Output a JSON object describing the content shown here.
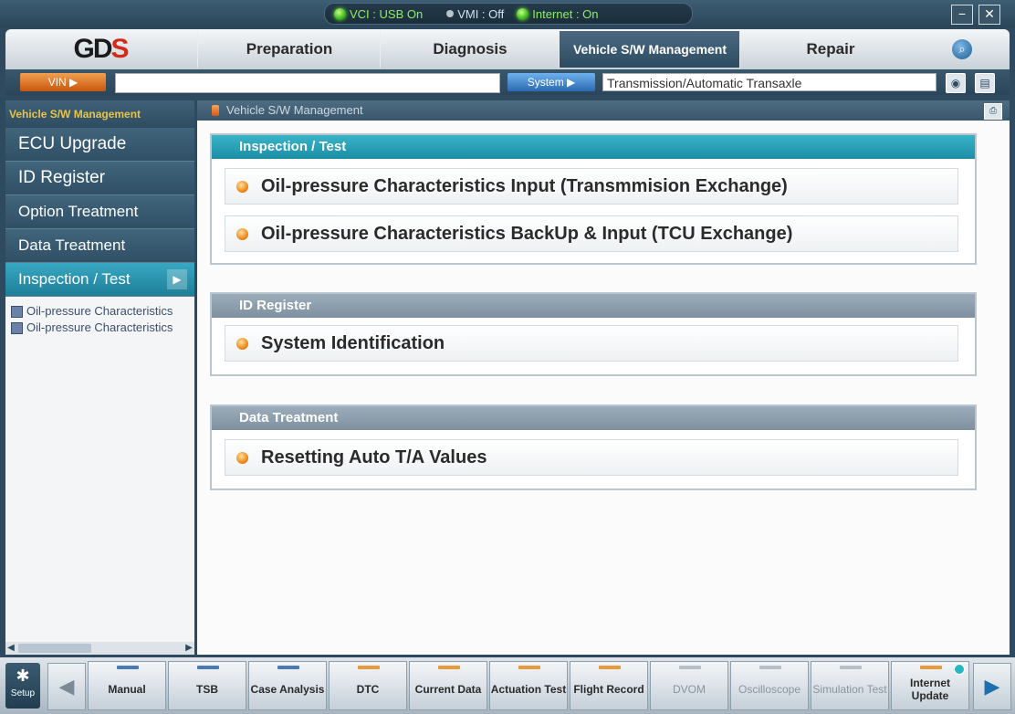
{
  "status": {
    "vci": "VCI : USB On",
    "vmi": "VMI : Off",
    "internet": "Internet : On"
  },
  "window": {
    "minimize": "−",
    "close": "✕"
  },
  "logo": {
    "part1": "GD",
    "part2": "S"
  },
  "menu": {
    "tabs": [
      {
        "label": "Preparation"
      },
      {
        "label": "Diagnosis"
      },
      {
        "label": "Vehicle S/W Management"
      },
      {
        "label": "Repair"
      }
    ],
    "search_icon": "🔍"
  },
  "address": {
    "vin_label": "VIN  ▶",
    "vin_value": "",
    "system_label": "System  ▶",
    "system_value": "Transmission/Automatic Transaxle"
  },
  "sidebar": {
    "header": "Vehicle S/W Management",
    "items": [
      {
        "label": "ECU Upgrade"
      },
      {
        "label": "ID Register"
      },
      {
        "label": "Option Treatment"
      },
      {
        "label": "Data Treatment"
      },
      {
        "label": "Inspection / Test"
      }
    ],
    "subitems": [
      {
        "label": "Oil-pressure  Characteristics"
      },
      {
        "label": "Oil-pressure  Characteristics"
      }
    ]
  },
  "content": {
    "header": "Vehicle S/W Management",
    "panels": [
      {
        "title": "Inspection / Test",
        "items": [
          "Oil-pressure Characteristics Input (Transmmision Exchange)",
          "Oil-pressure Characteristics BackUp & Input (TCU Exchange)"
        ]
      },
      {
        "title": "ID Register",
        "items": [
          "System Identification"
        ]
      },
      {
        "title": "Data Treatment",
        "items": [
          "Resetting Auto T/A Values"
        ]
      }
    ]
  },
  "toolbar": {
    "setup": "Setup",
    "tools": [
      {
        "label": "Manual"
      },
      {
        "label": "TSB"
      },
      {
        "label": "Case Analysis"
      },
      {
        "label": "DTC"
      },
      {
        "label": "Current Data"
      },
      {
        "label": "Actuation Test"
      },
      {
        "label": "Flight Record"
      },
      {
        "label": "DVOM"
      },
      {
        "label": "Oscilloscope"
      },
      {
        "label": "Simulation Test"
      },
      {
        "label": "Internet Update"
      }
    ]
  },
  "colors": {
    "accent": "#1f8ea6",
    "active_tab": "#2d4b60",
    "status_green": "#3cb81c"
  }
}
